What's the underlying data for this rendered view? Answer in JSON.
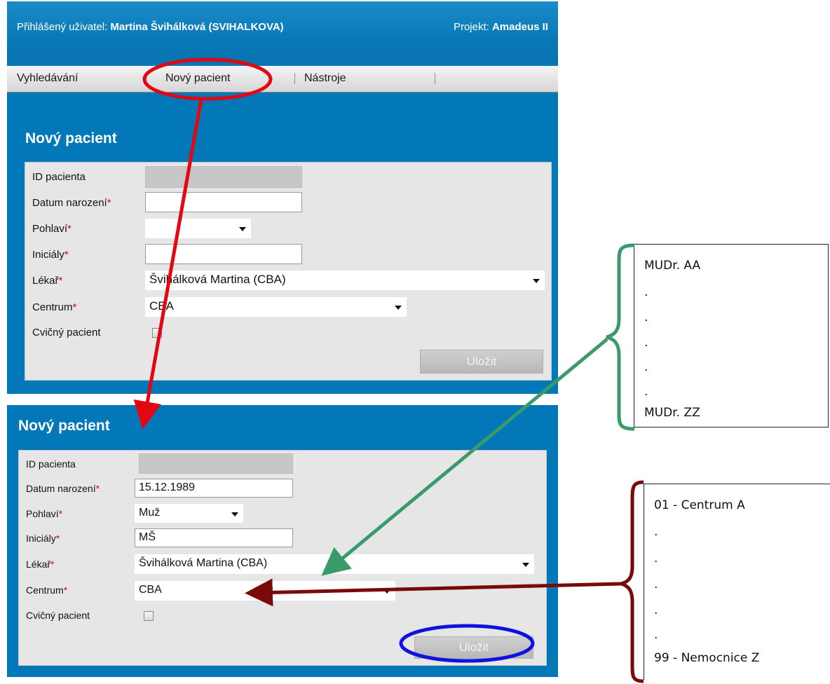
{
  "header": {
    "user_label": "Přihlášený uživatel:",
    "user_name": "Martina Švihálková (SVIHALKOVA)",
    "project_label": "Projekt:",
    "project_name": "Amadeus II"
  },
  "nav": {
    "items": [
      "Vyhledávání",
      "Nový pacient",
      "Nástroje"
    ]
  },
  "form_empty": {
    "title": "Nový pacient",
    "labels": {
      "patient_id": "ID pacienta",
      "birth_date": "Datum narození",
      "sex": "Pohlaví",
      "initials": "Iniciály",
      "doctor": "Lékař",
      "center": "Centrum",
      "practice": "Cvičný pacient"
    },
    "required_mark": "*",
    "values": {
      "patient_id": "",
      "birth_date": "",
      "sex": "",
      "initials": "",
      "doctor": "Švihálková Martina (CBA)",
      "center": "CBA"
    },
    "save_label": "Uložit"
  },
  "form_filled": {
    "title": "Nový pacient",
    "labels": {
      "patient_id": "ID pacienta",
      "birth_date": "Datum narození",
      "sex": "Pohlaví",
      "initials": "Iniciály",
      "doctor": "Lékař",
      "center": "Centrum",
      "practice": "Cvičný pacient"
    },
    "required_mark": "*",
    "values": {
      "patient_id": "",
      "birth_date": "15.12.1989",
      "sex": "Muž",
      "initials": "MŠ",
      "doctor": "Švihálková Martina (CBA)",
      "center": "CBA"
    },
    "save_label": "Uložit"
  },
  "annotations": {
    "doctor_list": {
      "first": "MUDr. AA",
      "dots": [
        ".",
        ".",
        ".",
        ".",
        "."
      ],
      "last": "MUDr. ZZ"
    },
    "center_list": {
      "first": "01 - Centrum A",
      "dots": [
        ".",
        ".",
        ".",
        ".",
        "."
      ],
      "last": "99 - Nemocnice Z"
    },
    "colors": {
      "nav_highlight": "#e30613",
      "arrow_red": "#e30613",
      "arrow_green": "#3a9a6a",
      "arrow_dark_red": "#7a0a0a",
      "save_highlight": "#1010e0",
      "app_blue": "#0278b8"
    }
  }
}
